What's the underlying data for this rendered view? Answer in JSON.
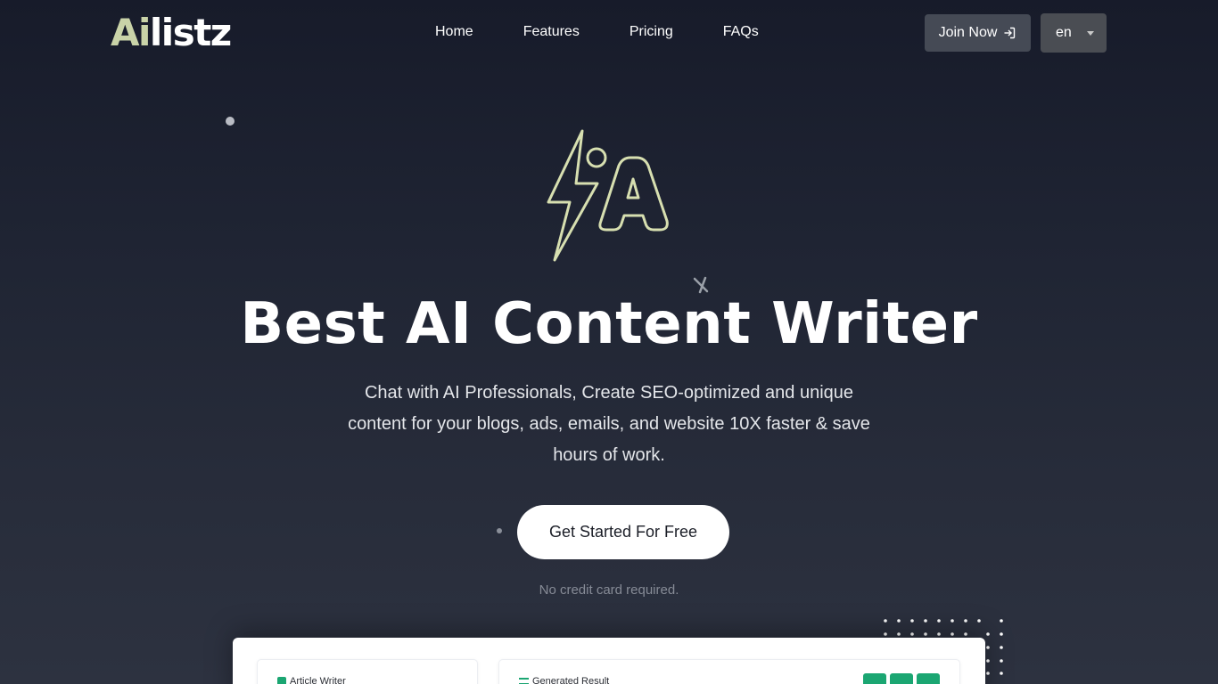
{
  "nav": {
    "logo_ai": "Ai",
    "logo_rest": "listz",
    "links": [
      "Home",
      "Features",
      "Pricing",
      "FAQs"
    ],
    "join_label": "Join Now",
    "lang_label": "en"
  },
  "hero": {
    "title": "Best AI Content Writer",
    "subtitle": "Chat with AI Professionals, Create SEO-optimized and unique content for your blogs, ads, emails, and website 10X faster & save hours of work.",
    "cta_label": "Get Started For Free",
    "note": "No credit card required."
  },
  "preview": {
    "left_title": "Article Writer",
    "right_title": "Generated Result"
  },
  "colors": {
    "accent_logo": "#c9d3a8",
    "mark_stroke": "#d7dfb0",
    "action_green": "#1ba672"
  },
  "icons": {
    "join": "login-arrow-icon",
    "lang": "caret-down-icon",
    "hero_mark": "lightning-a-logo-icon"
  }
}
